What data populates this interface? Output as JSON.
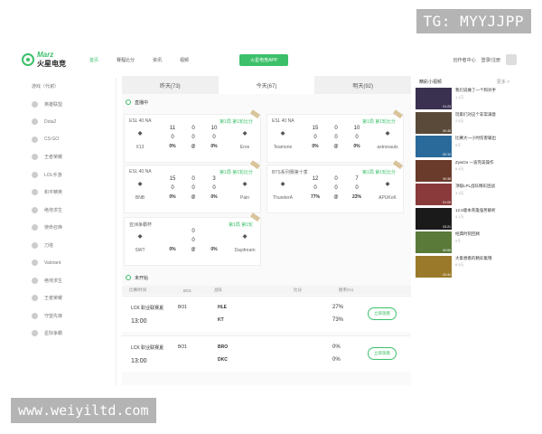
{
  "watermark_top": "TG: MYYJJPP",
  "watermark_bottom": "www.weiyiltd.com",
  "header": {
    "logo_en": "Marz",
    "logo_cn": "火星电竞",
    "nav": [
      "首页",
      "赛程比分",
      "资讯",
      "视频"
    ],
    "app_btn": "火星电竞APP",
    "creator": "创作者中心",
    "login": "登录/注册"
  },
  "sidebar": {
    "items": [
      "游戏（代谢）",
      "英雄联盟",
      "Dota2",
      "CS:GO",
      "王者荣耀",
      "LOL手游",
      "和平精英",
      "绝地求生",
      "使命召唤",
      "刀塔",
      "Valorant",
      "绝地求生",
      "王者荣耀",
      "守望先锋",
      "星际争霸"
    ]
  },
  "tabs": [
    "昨天(73)",
    "今天(67)",
    "明天(92)"
  ],
  "live_label": "直播中",
  "cards": [
    {
      "league": "ESL 40 NA",
      "round": "第1局 第1轮比分",
      "left": "X13",
      "right": "Eros",
      "s1": [
        "11",
        "0",
        "10"
      ],
      "s2": [
        "0",
        "0",
        "0"
      ],
      "p": [
        "0%",
        "@",
        "0%"
      ]
    },
    {
      "league": "ESL 40 NA",
      "round": "第1局 第1轮比分",
      "left": "Teamone",
      "right": "astronauts",
      "s1": [
        "15",
        "0",
        "10"
      ],
      "s2": [
        "0",
        "0",
        "0"
      ],
      "p": [
        "0%",
        "@",
        "0%"
      ]
    },
    {
      "league": "ESL 40 NA",
      "round": "第1局 第1轮比分",
      "left": "BNB",
      "right": "Pain",
      "s1": [
        "15",
        "0",
        "3"
      ],
      "s2": [
        "0",
        "0",
        "0"
      ],
      "p": [
        "0%",
        "@",
        "0%"
      ]
    },
    {
      "league": "BTS系列赛第十季",
      "round": "第1局 第1轮比分",
      "left": "ThunderA",
      "right": "APUKoK",
      "s1": [
        "12",
        "0",
        "7"
      ],
      "s2": [
        "0",
        "0",
        "0"
      ],
      "p": [
        "77%",
        "@",
        "23%"
      ]
    },
    {
      "league": "亚洲争霸杯",
      "round": "第1局 第1轮",
      "left": "SWT",
      "right": "Daydream",
      "s1": [
        "",
        "0",
        ""
      ],
      "s2": [
        "",
        "0",
        ""
      ],
      "p": [
        "0%",
        "@",
        "0%"
      ]
    }
  ],
  "upcoming_label": "未开始",
  "table_head": [
    "比赛/时间",
    "BO1",
    "战队",
    "比分",
    "胜率(%)"
  ],
  "matches": [
    {
      "league": "LCK 职业联赛夏",
      "bo": "BO1",
      "time": "13:00",
      "t1": "HLE",
      "t2": "KT",
      "p1": "27%",
      "p2": "73%",
      "btn": "立即观看"
    },
    {
      "league": "LCK 职业联赛夏",
      "bo": "BO1",
      "time": "13:00",
      "t1": "BRO",
      "t2": "DKC",
      "p1": "0%",
      "p2": "0%",
      "btn": "立即观看"
    }
  ],
  "right": {
    "title": "精彩小视频",
    "more": "更多 >",
    "videos": [
      {
        "title": "我们说做了一个和对手",
        "meta": "1.2万",
        "dur": "01:23"
      },
      {
        "title": "玩家们对这个非常满意",
        "meta": "2.6万",
        "dur": "00:45"
      },
      {
        "title": "比赛大一小时伤害输出",
        "meta": "5千",
        "dur": "02:10"
      },
      {
        "title": "ZywOo 一波完美操作",
        "meta": "8.4万",
        "dur": "00:38"
      },
      {
        "title": "顶级LPL战队精彩团战",
        "meta": "3.3万",
        "dur": "01:05"
      },
      {
        "title": "12.5版本英雄强势解析",
        "meta": "4.1万",
        "dur": "03:21"
      },
      {
        "title": "经典时刻回顾",
        "meta": "9千",
        "dur": "00:59"
      },
      {
        "title": "大家想看的精彩集锦",
        "meta": "6.5万",
        "dur": "02:44"
      }
    ]
  }
}
